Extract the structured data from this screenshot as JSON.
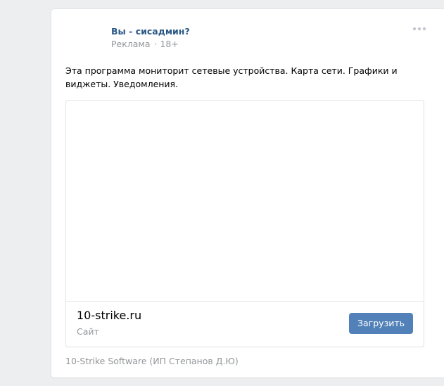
{
  "post": {
    "title": "Вы - сисадмин?",
    "ad_label": "Реклама",
    "age_rating": "· 18+",
    "text": "Эта программа мониторит сетевые устройства. Карта сети. Графики и виджеты. Уведомления.",
    "more_icon": "more-horizontal-icon"
  },
  "snippet": {
    "domain": "10-strike.ru",
    "type_label": "Сайт",
    "button_label": "Загрузить"
  },
  "advertiser": {
    "name": "10-Strike Software (ИП Степанов Д.Ю)"
  },
  "colors": {
    "link": "#2a5885",
    "muted": "#939699",
    "button": "#5181b8",
    "background": "#edeef0"
  }
}
